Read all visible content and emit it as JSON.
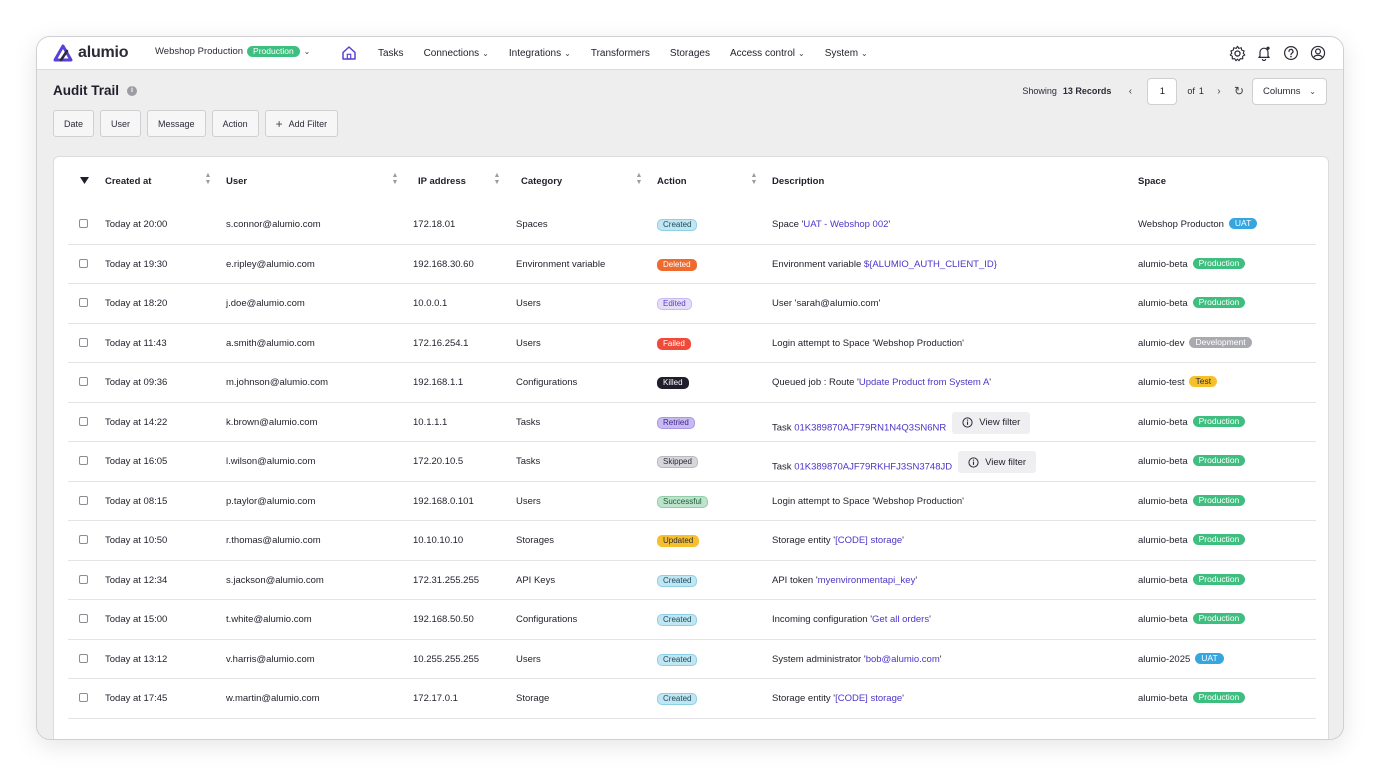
{
  "app": {
    "logo_text": "alumio",
    "environment": {
      "name": "Webshop Production",
      "badge": "Production"
    },
    "nav": [
      {
        "label": "Tasks",
        "dropdown": false
      },
      {
        "label": "Connections",
        "dropdown": true
      },
      {
        "label": "Integrations",
        "dropdown": true
      },
      {
        "label": "Transformers",
        "dropdown": false
      },
      {
        "label": "Storages",
        "dropdown": false
      },
      {
        "label": "Access control",
        "dropdown": true
      },
      {
        "label": "System",
        "dropdown": true
      }
    ],
    "top_icons": [
      "settings-icon",
      "bell-icon",
      "help-icon",
      "user-icon"
    ]
  },
  "page": {
    "title": "Audit Trail",
    "pager": {
      "showing_label": "Showing",
      "records": "13 Records",
      "page": "1",
      "of_label": "of",
      "total_pages": "1"
    },
    "columns_label": "Columns",
    "filters": [
      "Date",
      "User",
      "Message",
      "Action"
    ],
    "add_filter_label": "Add Filter"
  },
  "colors": {
    "accent": "#4b36c9",
    "production": "#3fbf7f",
    "uat": "#35a6e0",
    "development": "#a9a9b0",
    "test": "#f6c02d"
  },
  "table": {
    "headers": {
      "created_at": "Created at",
      "user": "User",
      "ip": "IP address",
      "category": "Category",
      "action": "Action",
      "description": "Description",
      "space": "Space"
    },
    "rows": [
      {
        "created": "Today at 20:00",
        "user": "s.connor@alumio.com",
        "ip": "172.18.01",
        "category": "Spaces",
        "action": "Created",
        "action_style": "created",
        "desc_pre": "Space '",
        "desc_link": "UAT - Webshop 002",
        "desc_post": "'",
        "view_filter": "",
        "space": "Webshop Producton",
        "space_badge": "UAT",
        "badge_style": "uat"
      },
      {
        "created": "Today at 19:30",
        "user": "e.ripley@alumio.com",
        "ip": "192.168.30.60",
        "category": "Environment variable",
        "action": "Deleted",
        "action_style": "deleted",
        "desc_pre": "Environment variable ",
        "desc_link": "${ALUMIO_AUTH_CLIENT_ID}",
        "desc_post": "",
        "view_filter": "",
        "space": "alumio-beta",
        "space_badge": "Production",
        "badge_style": "prod"
      },
      {
        "created": "Today at 18:20",
        "user": "j.doe@alumio.com",
        "ip": "10.0.0.1",
        "category": "Users",
        "action": "Edited",
        "action_style": "edited",
        "desc_pre": "User 'sarah@alumio.com'",
        "desc_link": "",
        "desc_post": "",
        "view_filter": "",
        "space": "alumio-beta",
        "space_badge": "Production",
        "badge_style": "prod"
      },
      {
        "created": "Today at 11:43",
        "user": "a.smith@alumio.com",
        "ip": "172.16.254.1",
        "category": "Users",
        "action": "Failed",
        "action_style": "failed",
        "desc_pre": "Login attempt to Space 'Webshop Production'",
        "desc_link": "",
        "desc_post": "",
        "view_filter": "",
        "space": "alumio-dev",
        "space_badge": "Development",
        "badge_style": "dev"
      },
      {
        "created": "Today at 09:36",
        "user": "m.johnson@alumio.com",
        "ip": "192.168.1.1",
        "category": "Configurations",
        "action": "Killed",
        "action_style": "killed",
        "desc_pre": "Queued job : Route '",
        "desc_link": "Update Product from System A",
        "desc_post": "'",
        "view_filter": "",
        "space": "alumio-test",
        "space_badge": "Test",
        "badge_style": "test"
      },
      {
        "created": "Today at 14:22",
        "user": "k.brown@alumio.com",
        "ip": "10.1.1.1",
        "category": "Tasks",
        "action": "Retried",
        "action_style": "retried",
        "desc_pre": "Task ",
        "desc_link": "01K389870AJF79RN1N4Q3SN6NR",
        "desc_post": "",
        "view_filter": "View filter",
        "space": "alumio-beta",
        "space_badge": "Production",
        "badge_style": "prod"
      },
      {
        "created": "Today at 16:05",
        "user": "l.wilson@alumio.com",
        "ip": "172.20.10.5",
        "category": "Tasks",
        "action": "Skipped",
        "action_style": "skipped",
        "desc_pre": "Task ",
        "desc_link": "01K389870AJF79RKHFJ3SN3748JD",
        "desc_post": "",
        "view_filter": "View filter",
        "space": "alumio-beta",
        "space_badge": "Production",
        "badge_style": "prod"
      },
      {
        "created": "Today at 08:15",
        "user": "p.taylor@alumio.com",
        "ip": "192.168.0.101",
        "category": "Users",
        "action": "Successful",
        "action_style": "successful",
        "desc_pre": "Login attempt to Space 'Webshop Production'",
        "desc_link": "",
        "desc_post": "",
        "view_filter": "",
        "space": "alumio-beta",
        "space_badge": "Production",
        "badge_style": "prod"
      },
      {
        "created": "Today at 10:50",
        "user": "r.thomas@alumio.com",
        "ip": "10.10.10.10",
        "category": "Storages",
        "action": "Updated",
        "action_style": "updated",
        "desc_pre": "Storage entity '",
        "desc_link": "[CODE] storage",
        "desc_post": "'",
        "view_filter": "",
        "space": "alumio-beta",
        "space_badge": "Production",
        "badge_style": "prod"
      },
      {
        "created": "Today at 12:34",
        "user": "s.jackson@alumio.com",
        "ip": "172.31.255.255",
        "category": "API Keys",
        "action": "Created",
        "action_style": "created",
        "desc_pre": "API token '",
        "desc_link": "myenvironmentapi_key",
        "desc_post": "'",
        "view_filter": "",
        "space": "alumio-beta",
        "space_badge": "Production",
        "badge_style": "prod"
      },
      {
        "created": "Today at 15:00",
        "user": "t.white@alumio.com",
        "ip": "192.168.50.50",
        "category": "Configurations",
        "action": "Created",
        "action_style": "created",
        "desc_pre": "Incoming configuration '",
        "desc_link": "Get all orders",
        "desc_post": "'",
        "view_filter": "",
        "space": "alumio-beta",
        "space_badge": "Production",
        "badge_style": "prod"
      },
      {
        "created": "Today at 13:12",
        "user": "v.harris@alumio.com",
        "ip": "10.255.255.255",
        "category": "Users",
        "action": "Created",
        "action_style": "created",
        "desc_pre": "System administrator '",
        "desc_link": "bob@alumio.com",
        "desc_post": "'",
        "view_filter": "",
        "space": "alumio-2025",
        "space_badge": "UAT",
        "badge_style": "uat"
      },
      {
        "created": "Today at 17:45",
        "user": "w.martin@alumio.com",
        "ip": "172.17.0.1",
        "category": "Storage",
        "action": "Created",
        "action_style": "created",
        "desc_pre": "Storage entity '",
        "desc_link": "[CODE] storage",
        "desc_post": "'",
        "view_filter": "",
        "space": "alumio-beta",
        "space_badge": "Production",
        "badge_style": "prod"
      }
    ]
  }
}
